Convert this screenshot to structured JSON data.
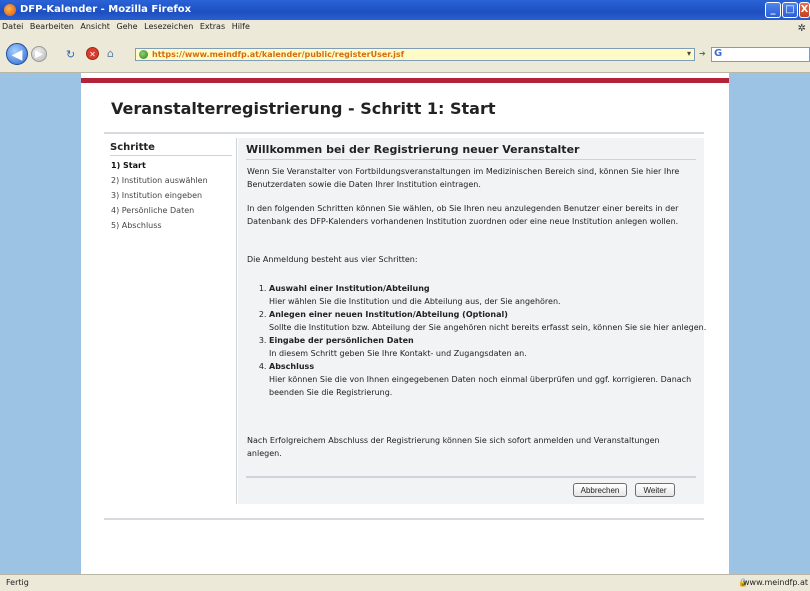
{
  "window": {
    "title": "DFP-Kalender - Mozilla Firefox",
    "minimize_glyph": "_",
    "maximize_glyph": "□",
    "close_glyph": "X"
  },
  "menu": {
    "items": [
      "Datei",
      "Bearbeiten",
      "Ansicht",
      "Gehe",
      "Lesezeichen",
      "Extras",
      "Hilfe"
    ]
  },
  "navigation": {
    "url": "https://www.meindfp.at/kalender/public/registerUser.jsf",
    "search_engine_glyph": "G"
  },
  "page": {
    "title": "Veranstalterregistrierung - Schritt 1: Start",
    "sidebar": {
      "heading": "Schritte",
      "steps": [
        "1) Start",
        "2) Institution auswählen",
        "3) Institution eingeben",
        "4) Persönliche Daten",
        "5) Abschluss"
      ]
    },
    "main": {
      "heading": "Willkommen bei der Registrierung neuer Veranstalter",
      "paragraphs": [
        "Wenn Sie Veranstalter von Fortbildungsveranstaltungen im Medizinischen Bereich sind, können Sie hier Ihre Benutzerdaten sowie die Daten Ihrer Institution eintragen.",
        "In den folgenden Schritten können Sie wählen, ob Sie Ihren neu anzulegenden Benutzer einer bereits in der Datenbank des DFP-Kalenders vorhandenen Institution zuordnen oder eine neue Institution anlegen wollen.",
        "Die Anmeldung besteht aus vier Schritten:"
      ],
      "list": [
        {
          "title": "Auswahl einer Institution/Abteilung",
          "text": "Hier wählen Sie die Institution und die Abteilung aus, der Sie angehören."
        },
        {
          "title": "Anlegen einer neuen Institution/Abteilung (Optional)",
          "text": "Sollte die Institution bzw. Abteilung der Sie angehören nicht bereits erfasst sein, können Sie sie hier anlegen."
        },
        {
          "title": "Eingabe der persönlichen Daten",
          "text": "In diesem Schritt geben Sie Ihre Kontakt- und Zugangsdaten an."
        },
        {
          "title": "Abschluss",
          "text": "Hier können Sie die von Ihnen eingegebenen Daten noch einmal überprüfen und ggf. korrigieren. Danach beenden Sie die Registrierung."
        }
      ],
      "closing": "Nach Erfolgreichem Abschluss der Registrierung können Sie sich sofort anmelden und Veranstaltungen anlegen.",
      "buttons": {
        "cancel": "Abbrechen",
        "next": "Weiter"
      }
    }
  },
  "statusbar": {
    "status": "Fertig",
    "domain": "www.meindfp.at"
  },
  "colors": {
    "accent_bar": "#b3243a",
    "url_text": "#d96b0c",
    "url_bg": "#fffbc7",
    "page_bg": "#9cc3e4"
  },
  "icons": [
    "firefox-icon",
    "back-icon",
    "forward-icon",
    "reload-icon",
    "stop-icon",
    "home-icon",
    "lock-icon",
    "go-icon",
    "search-engine-icon"
  ]
}
